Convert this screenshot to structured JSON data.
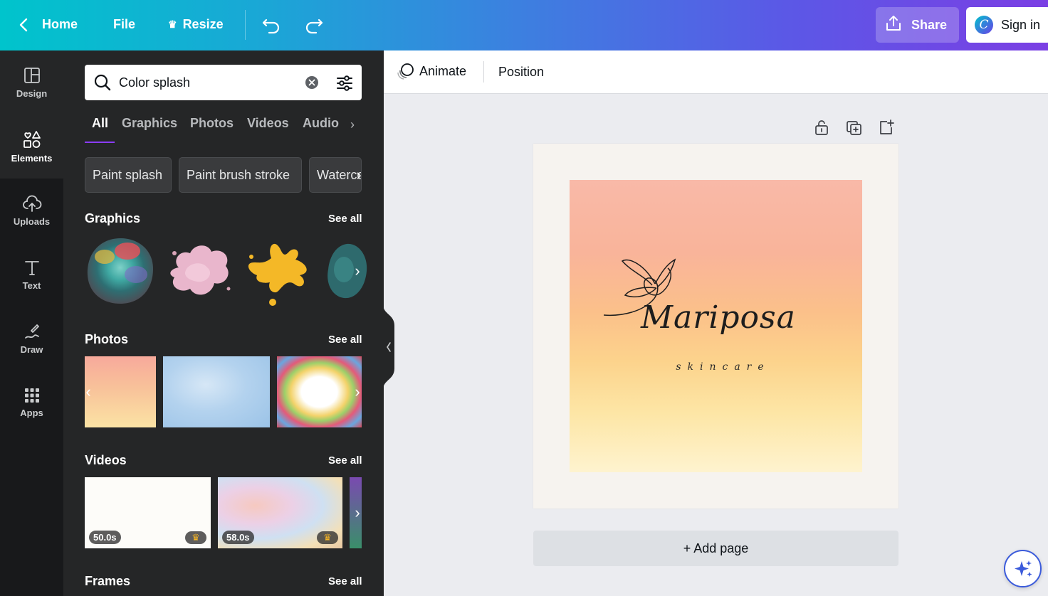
{
  "topbar": {
    "home": "Home",
    "file": "File",
    "resize": "Resize",
    "share": "Share",
    "signin": "Sign in",
    "logo_letter": "C"
  },
  "rail": {
    "items": [
      {
        "label": "Design",
        "icon": "layout-icon"
      },
      {
        "label": "Elements",
        "icon": "shapes-icon"
      },
      {
        "label": "Uploads",
        "icon": "cloud-upload-icon"
      },
      {
        "label": "Text",
        "icon": "text-icon"
      },
      {
        "label": "Draw",
        "icon": "pen-icon"
      },
      {
        "label": "Apps",
        "icon": "grid-icon"
      }
    ]
  },
  "panel": {
    "search": {
      "value": "Color splash",
      "placeholder": ""
    },
    "tabs": [
      "All",
      "Graphics",
      "Photos",
      "Videos",
      "Audio"
    ],
    "chips": [
      "Paint splash",
      "Paint brush stroke",
      "Watercolor"
    ],
    "sections": {
      "graphics": "Graphics",
      "photos": "Photos",
      "videos": "Videos",
      "frames": "Frames"
    },
    "see_all": "See all",
    "videos": [
      {
        "duration": "50.0s"
      },
      {
        "duration": "58.0s"
      }
    ]
  },
  "ctxbar": {
    "animate": "Animate",
    "position": "Position"
  },
  "canvas": {
    "brand_name": "Mariposa",
    "brand_sub": "skincare",
    "add_page": "+ Add page"
  },
  "colors": {
    "accent": "#8b3dff",
    "panel_bg": "#252627",
    "rail_bg": "#18191b",
    "canvas_bg": "#ebecf0"
  }
}
